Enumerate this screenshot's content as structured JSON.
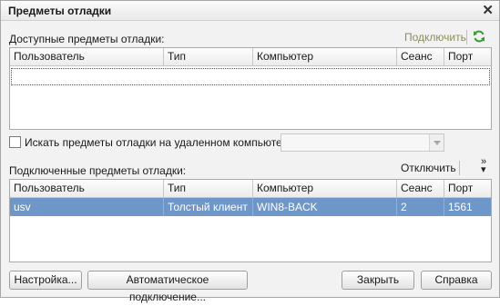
{
  "window": {
    "title": "Предметы отладки",
    "close_icon": "close-icon"
  },
  "available": {
    "label": "Доступные предметы отладки:",
    "connect_label": "Подключить",
    "refresh_icon": "refresh-icon",
    "columns": [
      "Пользователь",
      "Тип",
      "Компьютер",
      "Сеанс",
      "Порт"
    ]
  },
  "remote": {
    "checkbox_label": "Искать предметы отладки на удаленном компьютере:",
    "checked": false,
    "computer_value": ""
  },
  "connected": {
    "label": "Подключенные предметы отладки:",
    "disconnect_label": "Отключить",
    "more_icon": "double-chevron-icon",
    "columns": [
      "Пользователь",
      "Тип",
      "Компьютер",
      "Сеанс",
      "Порт"
    ],
    "rows": [
      {
        "user": "usv",
        "type": "Толстый клиент",
        "computer": "WIN8-BACK",
        "session": "2",
        "port": "1561"
      }
    ]
  },
  "buttons": {
    "settings": "Настройка...",
    "auto_connect": "Автоматическое подключение...",
    "close": "Закрыть",
    "help": "Справка"
  },
  "colors": {
    "selection": "#6e96c8",
    "refresh": "#3c9a3c"
  }
}
